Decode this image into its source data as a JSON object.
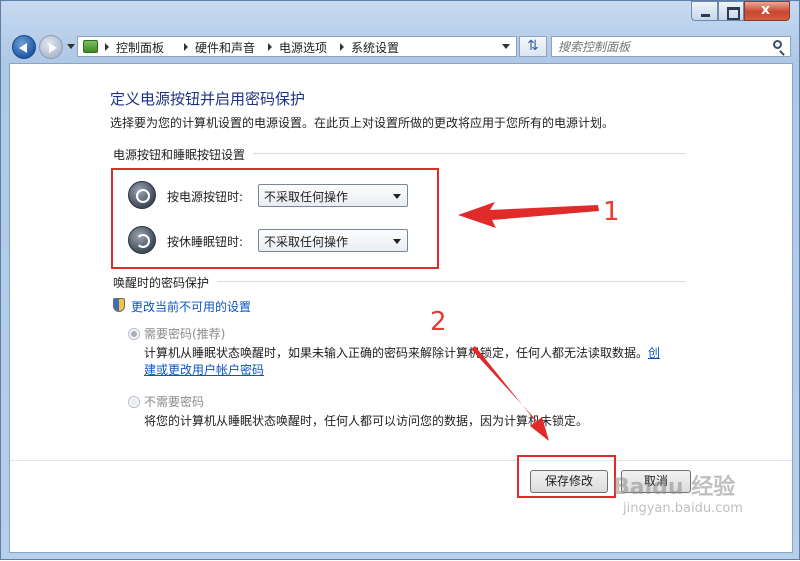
{
  "window": {
    "minimize_label": "",
    "close_label": "x"
  },
  "address": {
    "crumbs": [
      "控制面板",
      "硬件和声音",
      "电源选项",
      "系统设置"
    ]
  },
  "search": {
    "placeholder": "搜索控制面板"
  },
  "page": {
    "title": "定义电源按钮并启用密码保护",
    "description": "选择要为您的计算机设置的电源设置。在此页上对设置所做的更改将应用于您所有的电源计划。"
  },
  "power_section": {
    "heading": "电源按钮和睡眠按钮设置",
    "power_button": {
      "label": "按电源按钮时:",
      "value": "不采取任何操作"
    },
    "sleep_button": {
      "label": "按休睡眠钮时:",
      "value": "不采取任何操作"
    }
  },
  "password_section": {
    "heading": "唤醒时的密码保护",
    "change_link": "更改当前不可用的设置",
    "require": {
      "label": "需要密码(推荐)",
      "desc1": "计算机从睡眠状态唤醒时，如果未输入正确的密码来解除计算机锁定，任何人都无法读取数据。",
      "link_part1": "创",
      "link_part2": "建或更改用户帐户密码"
    },
    "no_require": {
      "label": "不需要密码",
      "desc": "将您的计算机从睡眠状态唤醒时，任何人都可以访问您的数据，因为计算机未锁定。"
    }
  },
  "buttons": {
    "save": "保存修改",
    "cancel": "取消"
  },
  "annotations": {
    "one": "1",
    "two": "2"
  },
  "watermark": {
    "line1": "Baidu 经验",
    "line2": "jingyan.baidu.com"
  },
  "colors": {
    "annotation_red": "#e12a2a",
    "title_blue": "#1e3287",
    "link_blue": "#0a55c4"
  }
}
